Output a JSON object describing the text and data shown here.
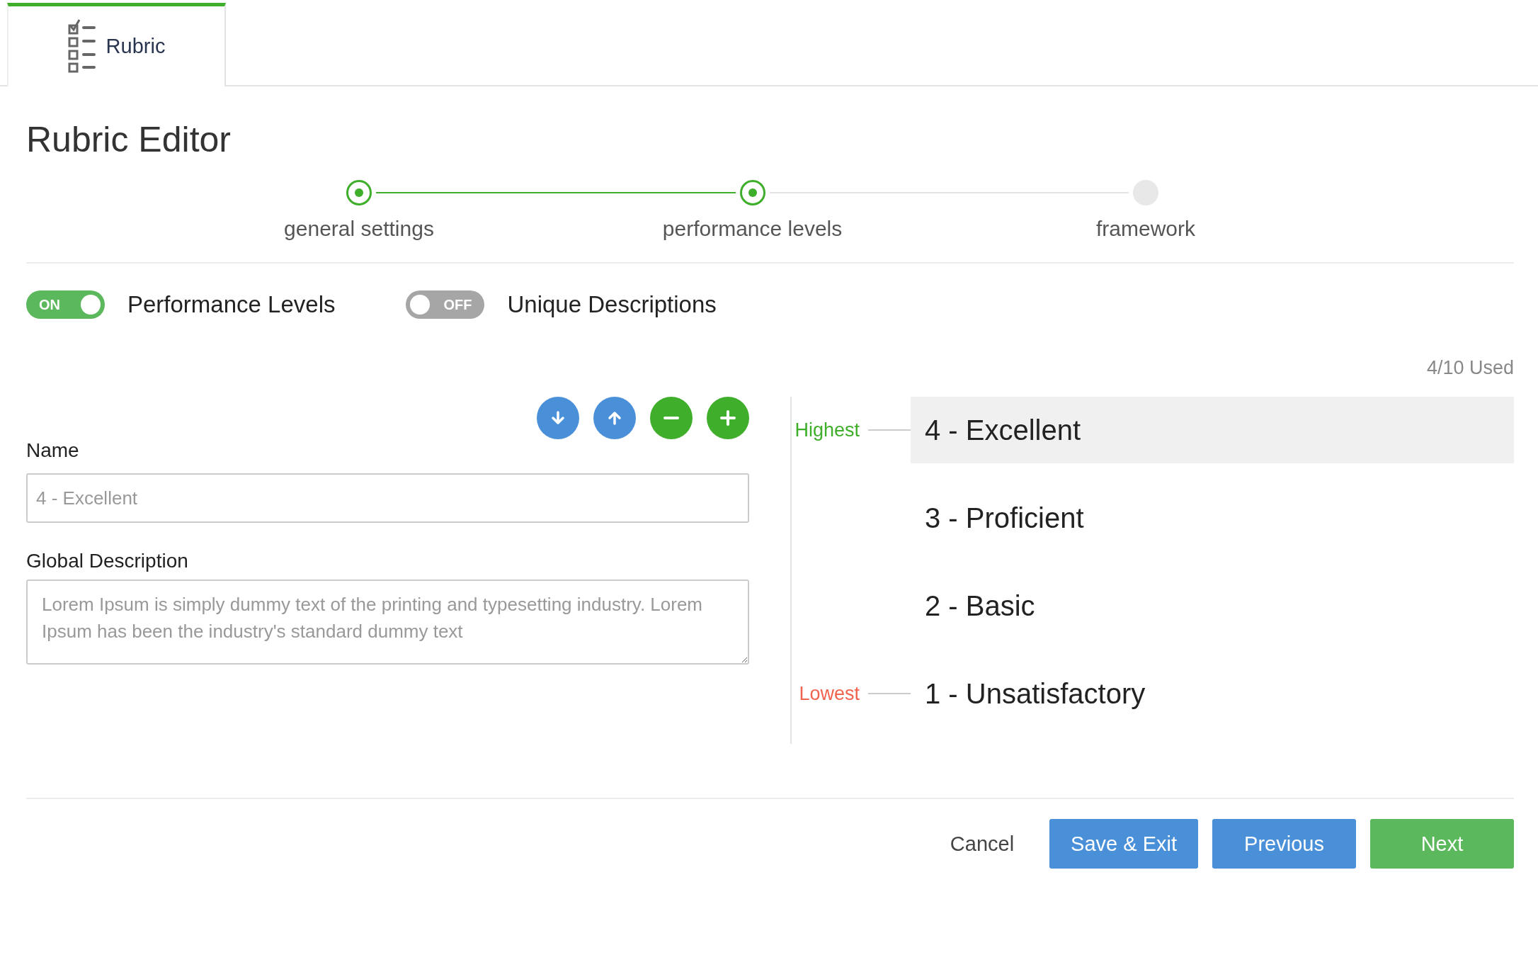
{
  "tab": {
    "label": "Rubric",
    "selected": true
  },
  "title": "Rubric Editor",
  "steps": [
    {
      "label": "general settings",
      "completed": true
    },
    {
      "label": "performance levels",
      "completed": true
    },
    {
      "label": "framework",
      "completed": false
    }
  ],
  "toggles": [
    {
      "label": "Performance Levels",
      "on": true,
      "state_text": "ON"
    },
    {
      "label": "Unique Descriptions",
      "on": false,
      "state_text": "OFF"
    }
  ],
  "usage": "4/10 Used",
  "form": {
    "name_label": "Name",
    "name_placeholder": "4 - Excellent",
    "description_label": "Global Description",
    "description_placeholder": "Lorem Ipsum is simply dummy text of the printing and typesetting industry. Lorem Ipsum has been the industry's standard dummy text"
  },
  "levels": [
    {
      "name": "4 - Excellent",
      "selected": true,
      "marker": {
        "label": "Highest",
        "kind": "highest"
      }
    },
    {
      "name": "3 - Proficient",
      "selected": false
    },
    {
      "name": "2 - Basic",
      "selected": false
    },
    {
      "name": "1 - Unsatisfactory",
      "selected": false,
      "marker": {
        "label": "Lowest",
        "kind": "lowest"
      }
    }
  ],
  "footer_buttons": [
    {
      "label": "Cancel",
      "kind": "plain"
    },
    {
      "label": "Save & Exit",
      "kind": "blue"
    },
    {
      "label": "Previous",
      "kind": "blue"
    },
    {
      "label": "Next",
      "kind": "green"
    }
  ]
}
